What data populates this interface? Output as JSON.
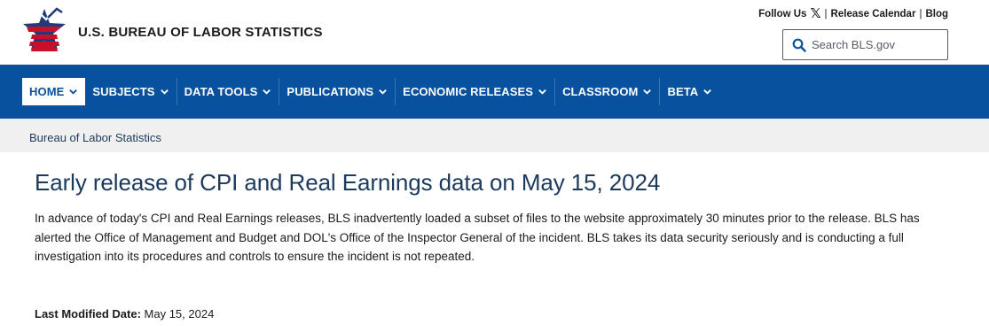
{
  "header": {
    "agency_name": "U.S. BUREAU OF LABOR STATISTICS",
    "follow_us": "Follow Us",
    "x_glyph": "𝕏",
    "separator": "|",
    "release_calendar": "Release Calendar",
    "blog": "Blog",
    "search_placeholder": "Search BLS.gov",
    "search_icon": "search-icon",
    "logo_colors": {
      "blue": "#1d3c78",
      "red": "#c8102e"
    }
  },
  "nav": {
    "background": "#07519e",
    "items": [
      {
        "label": "HOME",
        "active": true
      },
      {
        "label": "SUBJECTS",
        "active": false
      },
      {
        "label": "DATA TOOLS",
        "active": false
      },
      {
        "label": "PUBLICATIONS",
        "active": false
      },
      {
        "label": "ECONOMIC RELEASES",
        "active": false
      },
      {
        "label": "CLASSROOM",
        "active": false
      },
      {
        "label": "BETA",
        "active": false
      }
    ]
  },
  "breadcrumb": {
    "label": "Bureau of Labor Statistics"
  },
  "main": {
    "title": "Early release of CPI and Real Earnings data on May 15, 2024",
    "body": "In advance of today's CPI and Real Earnings releases, BLS inadvertently loaded a subset of files to the website approximately 30 minutes prior to the release. BLS has alerted the Office of Management and Budget and DOL's Office of the Inspector General of the incident. BLS takes its data security seriously and is conducting a full investigation into its procedures and controls to ensure the incident is not repeated.",
    "modified_label": "Last Modified Date:",
    "modified_value": "May 15, 2024"
  }
}
